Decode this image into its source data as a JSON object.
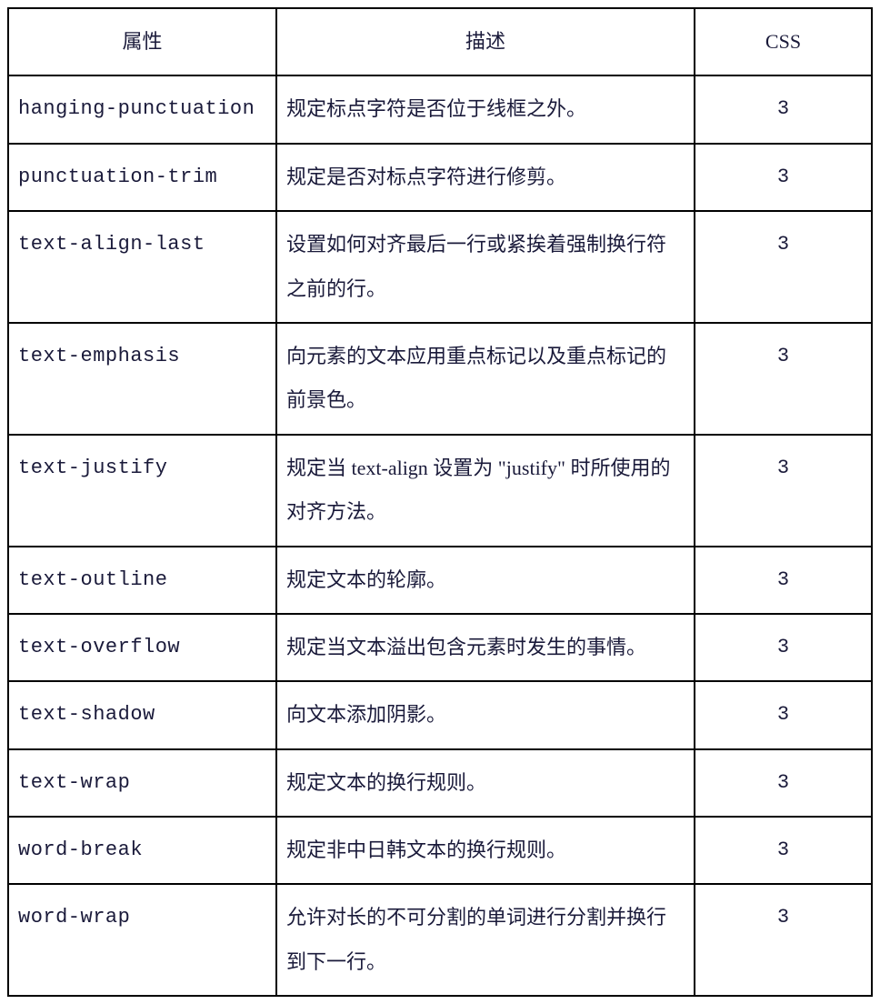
{
  "table": {
    "headers": {
      "property": "属性",
      "description": "描述",
      "css": "CSS"
    },
    "rows": [
      {
        "property": "hanging-punctuation",
        "description": "规定标点字符是否位于线框之外。",
        "css": "3"
      },
      {
        "property": "punctuation-trim",
        "description": "规定是否对标点字符进行修剪。",
        "css": "3"
      },
      {
        "property": "text-align-last",
        "description": "设置如何对齐最后一行或紧挨着强制换行符之前的行。",
        "css": "3"
      },
      {
        "property": "text-emphasis",
        "description": "向元素的文本应用重点标记以及重点标记的前景色。",
        "css": "3"
      },
      {
        "property": "text-justify",
        "description": "规定当 text-align 设置为 \"justify\" 时所使用的对齐方法。",
        "css": "3"
      },
      {
        "property": "text-outline",
        "description": "规定文本的轮廓。",
        "css": "3"
      },
      {
        "property": "text-overflow",
        "description": "规定当文本溢出包含元素时发生的事情。",
        "css": "3"
      },
      {
        "property": "text-shadow",
        "description": "向文本添加阴影。",
        "css": "3"
      },
      {
        "property": "text-wrap",
        "description": "规定文本的换行规则。",
        "css": "3"
      },
      {
        "property": "word-break",
        "description": "规定非中日韩文本的换行规则。",
        "css": "3"
      },
      {
        "property": "word-wrap",
        "description": "允许对长的不可分割的单词进行分割并换行到下一行。",
        "css": "3"
      }
    ]
  }
}
